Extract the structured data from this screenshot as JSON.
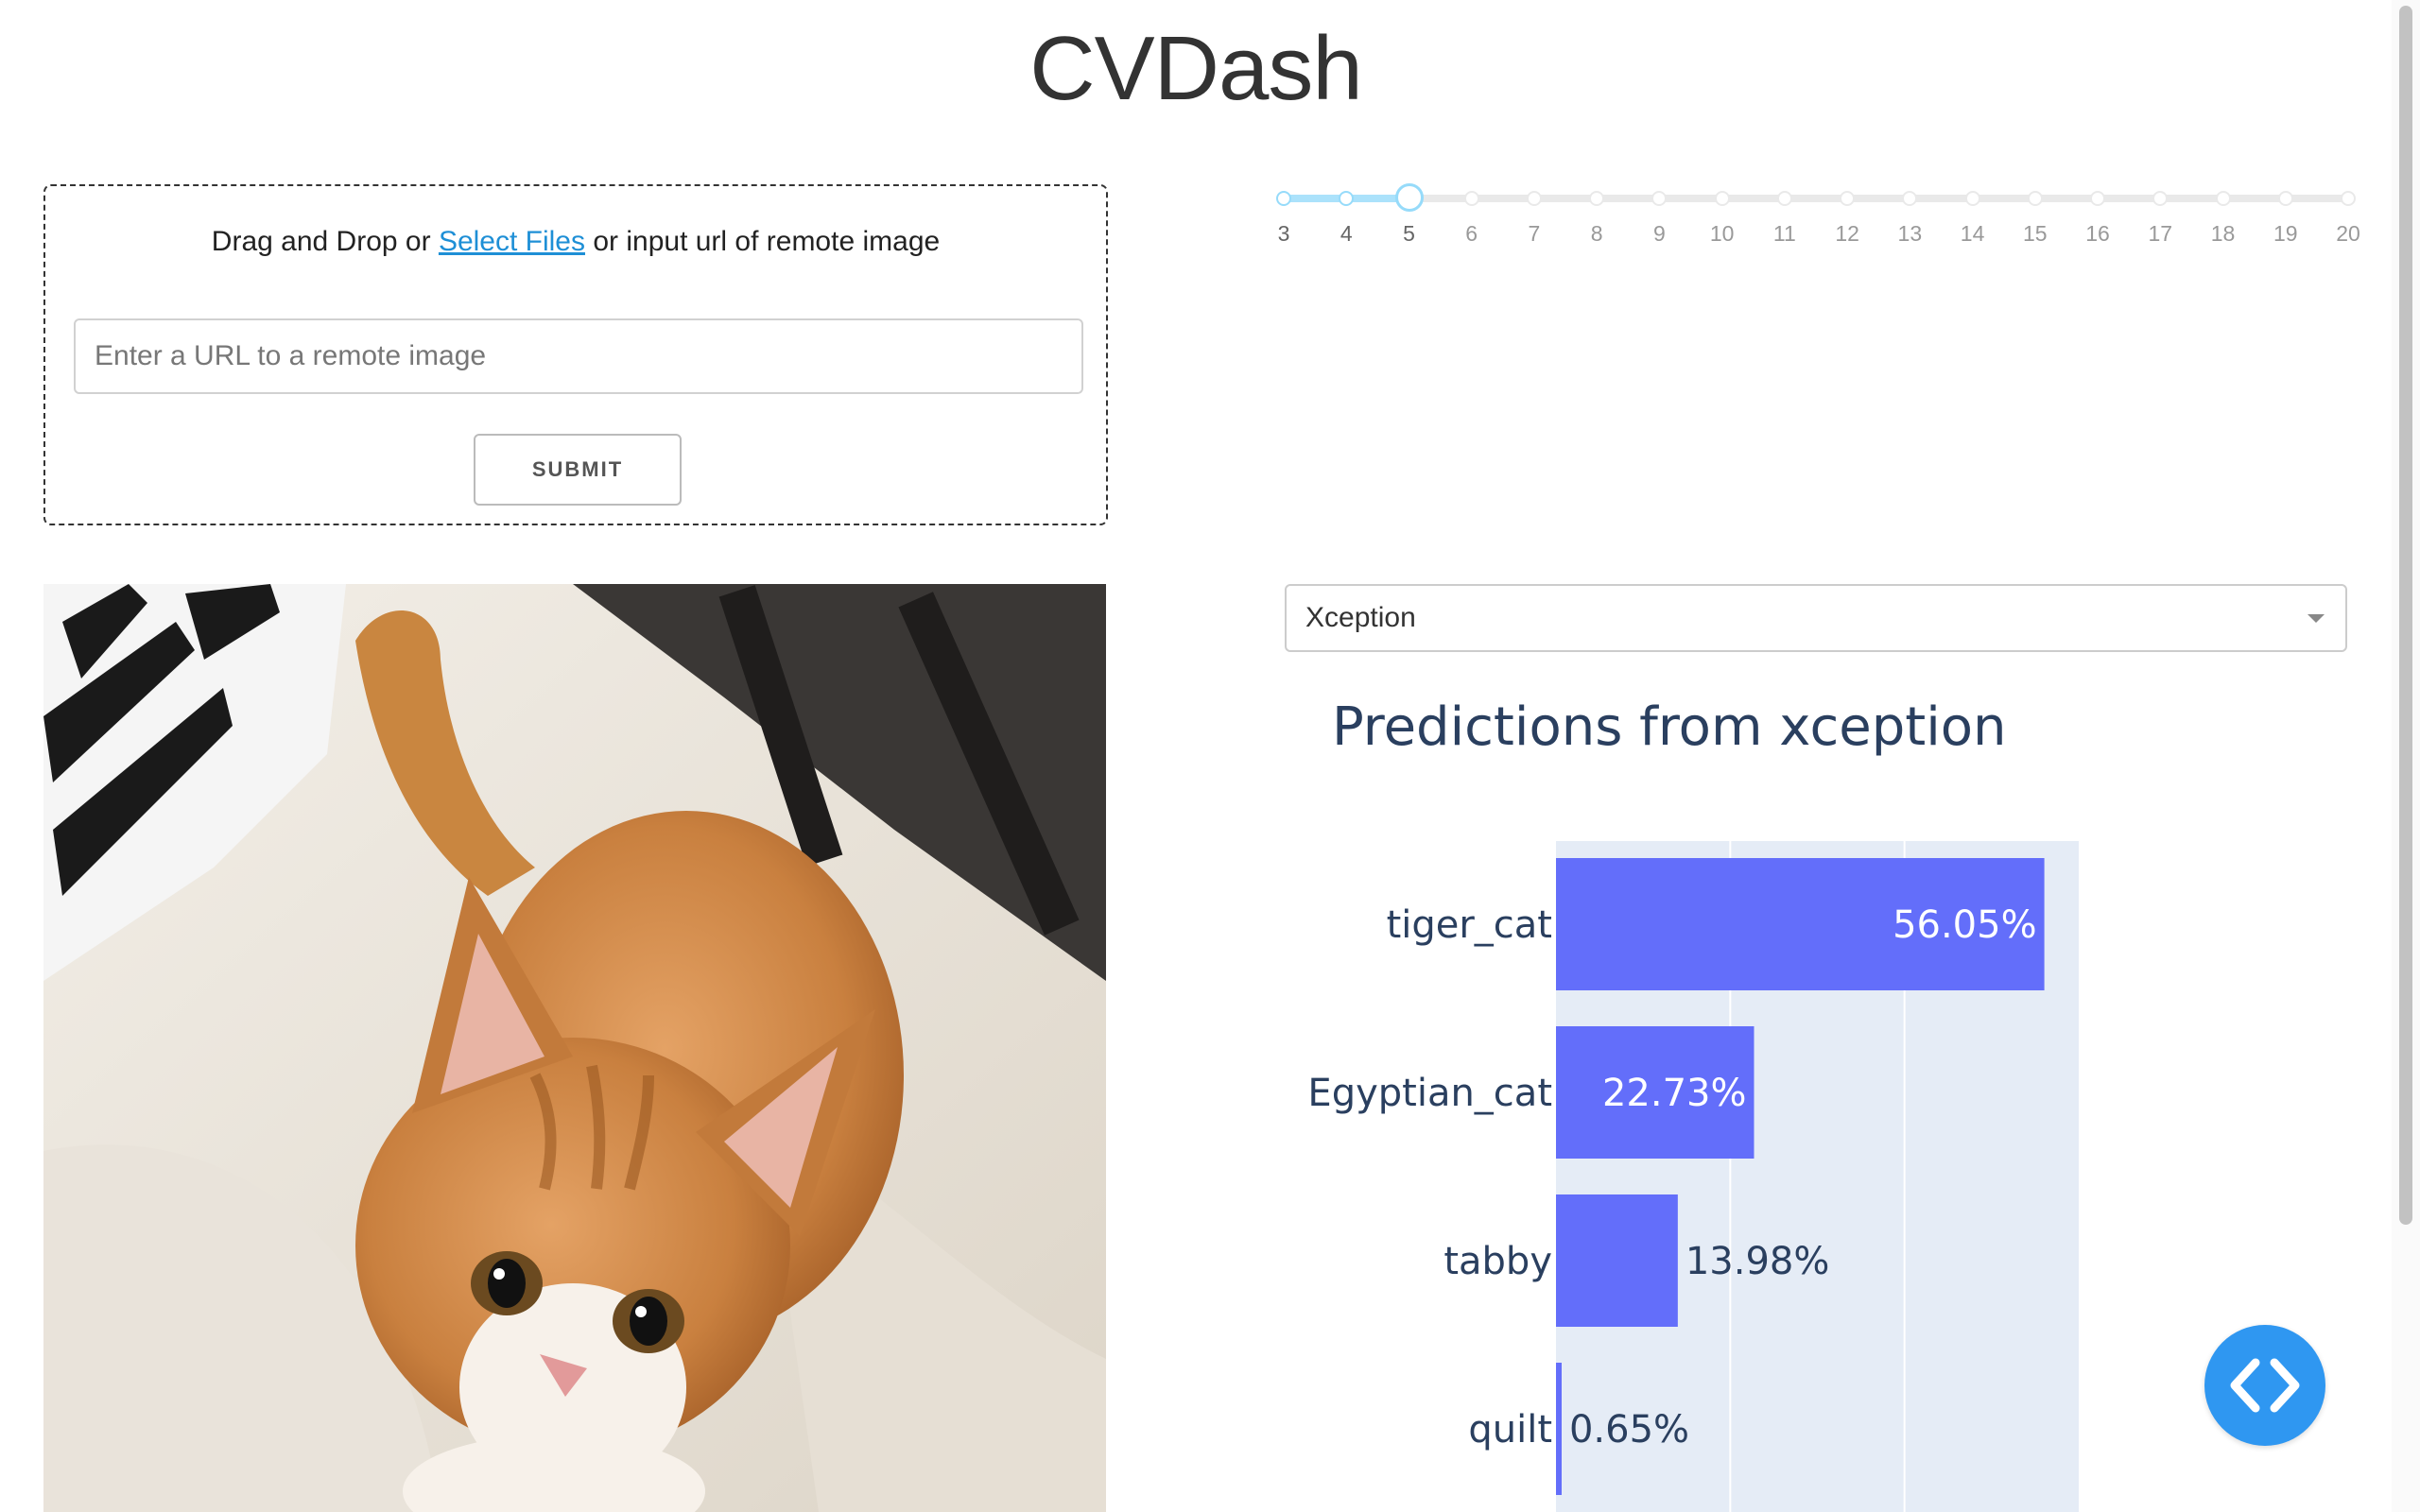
{
  "app": {
    "title": "CVDash"
  },
  "upload": {
    "text_before": "Drag and Drop or",
    "link_text": "Select Files",
    "text_after": "or input url of remote image",
    "url_placeholder": "Enter a URL to a remote image",
    "submit_label": "SUBMIT"
  },
  "slider": {
    "min": 3,
    "max": 20,
    "value": 5,
    "marks": [
      "3",
      "4",
      "5",
      "6",
      "7",
      "8",
      "9",
      "10",
      "11",
      "12",
      "13",
      "14",
      "15",
      "16",
      "17",
      "18",
      "19",
      "20"
    ]
  },
  "model_select": {
    "selected": "Xception"
  },
  "colors": {
    "bar": "#636efa",
    "plot_bg": "#e5ecf6",
    "title_text": "#2a3f5f",
    "accent": "#2f97f1"
  },
  "chart_data": {
    "type": "bar",
    "orientation": "horizontal",
    "title": "Predictions from xception",
    "categories": [
      "tiger_cat",
      "Egyptian_cat",
      "tabby",
      "quilt"
    ],
    "values": [
      56.05,
      22.73,
      13.98,
      0.65
    ],
    "labels": [
      "56.05%",
      "22.73%",
      "13.98%",
      "0.65%"
    ],
    "xlim": [
      0,
      60
    ],
    "grid": true
  },
  "fab": {
    "icon": "code-icon"
  }
}
